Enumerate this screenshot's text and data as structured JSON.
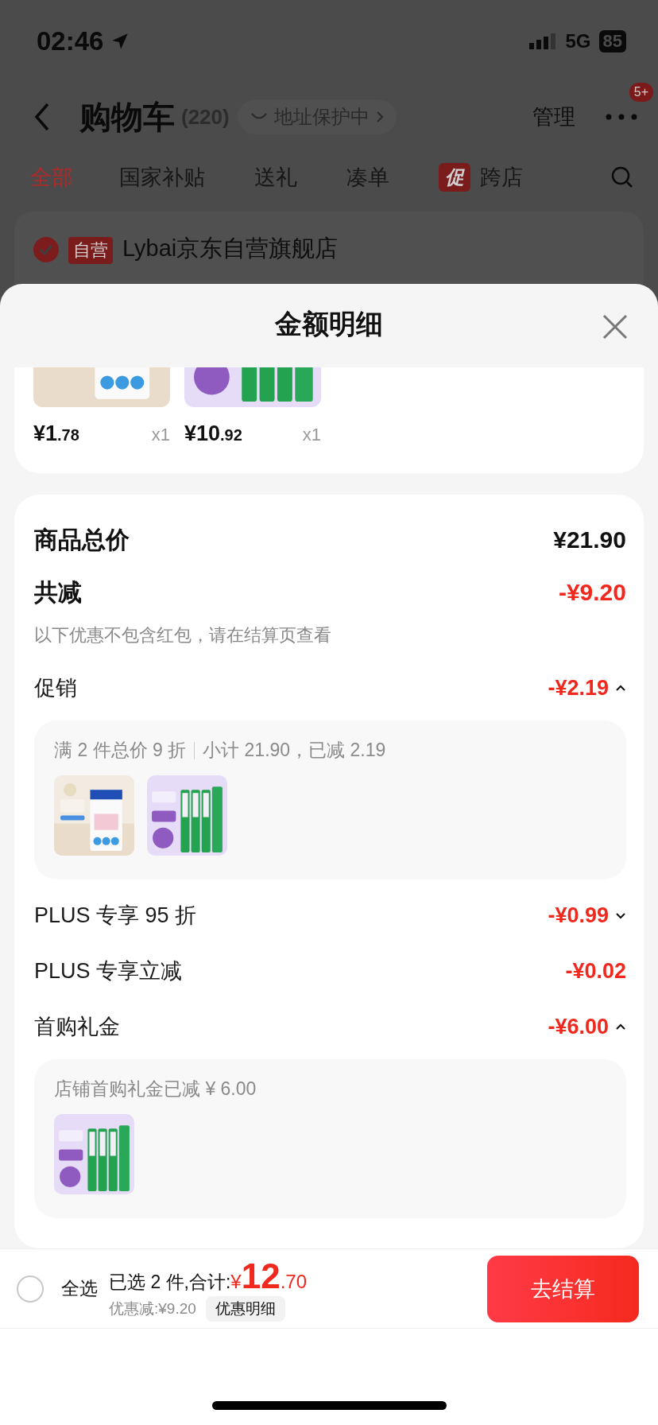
{
  "status_bar": {
    "time": "02:46",
    "network": "5G",
    "battery": "85"
  },
  "nav": {
    "title": "购物车",
    "count": "(220)",
    "address_pill": "地址保护中",
    "manage": "管理",
    "badge": "5+"
  },
  "tabs": [
    {
      "label": "全部",
      "selected": true
    },
    {
      "label": "国家补贴",
      "selected": false
    },
    {
      "label": "送礼",
      "selected": false
    },
    {
      "label": "凑单",
      "selected": false
    },
    {
      "label": "跨店",
      "selected": false,
      "tag": "促"
    }
  ],
  "store": {
    "checked": true,
    "tag": "自营",
    "name": "Lybai京东自营旗舰店"
  },
  "sheet": {
    "title": "金额明细"
  },
  "items": [
    {
      "kind": "picture",
      "price_int": "¥1",
      "price_dec": ".78",
      "qty": "x1"
    },
    {
      "kind": "picture",
      "price_int": "¥10",
      "price_dec": ".92",
      "qty": "x1"
    }
  ],
  "summary": {
    "total_label": "商品总价",
    "total_value": "¥21.90",
    "reduction_label": "共减",
    "reduction_value": "-¥9.20",
    "note": "以下优惠不包含红包，请在结算页查看"
  },
  "discounts": [
    {
      "kind": "expandable",
      "label": "促销",
      "value": "-¥2.19",
      "expanded": true,
      "detail": {
        "rule": "满 2 件总价 9 折",
        "text": "小计 21.90，已减 2.19"
      }
    },
    {
      "kind": "expandable",
      "label": "PLUS 专享 95 折",
      "value": "-¥0.99",
      "expanded": false
    },
    {
      "kind": "plain",
      "label": "PLUS 专享立减",
      "value": "-¥0.02"
    },
    {
      "kind": "expandable",
      "label": "首购礼金",
      "value": "-¥6.00",
      "expanded": true,
      "detail": {
        "text": "店铺首购礼金已减 ¥ 6.00"
      }
    }
  ],
  "bottom_bar": {
    "select_all": {
      "label": "全选",
      "checked": false
    },
    "selected_text": "已选 2 件,合计:",
    "currency": "¥",
    "total_int": "12",
    "total_dec": ".70",
    "discount": "优惠减:¥9.20",
    "details_button": "优惠明细",
    "checkout": "去结算"
  }
}
